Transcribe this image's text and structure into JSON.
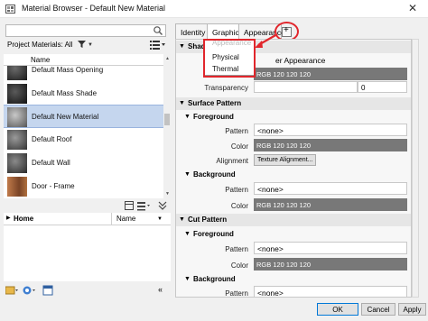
{
  "window": {
    "title": "Material Browser - Default New Material",
    "close_glyph": "✕"
  },
  "search": {
    "placeholder": ""
  },
  "project": {
    "label": "Project Materials: All",
    "column_name": "Name"
  },
  "materials": [
    {
      "label": "Default Mass Opening",
      "thumb": "#3a3a3a"
    },
    {
      "label": "Default Mass Shade",
      "thumb": "#2a2a2a"
    },
    {
      "label": "Default New Material",
      "thumb": "#777777",
      "selected": true
    },
    {
      "label": "Default Roof",
      "thumb": "#5a5a5a"
    },
    {
      "label": "Default Wall",
      "thumb": "#4a4a4a"
    },
    {
      "label": "Door - Frame",
      "thumb": "#a0643c"
    }
  ],
  "library": {
    "home_label": "Home",
    "name_label": "Name"
  },
  "tabs": [
    {
      "label": "Identity"
    },
    {
      "label": "Graphics",
      "active": true
    },
    {
      "label": "Appearance"
    }
  ],
  "add_asset": {
    "glyph": "+"
  },
  "popup_menu": {
    "items": [
      "Appearance",
      "Physical",
      "Thermal"
    ]
  },
  "shading": {
    "header": "Shading",
    "use_render": "er Appearance",
    "color_value": "RGB 120 120 120",
    "transparency_label": "Transparency",
    "transparency_value": "0"
  },
  "surface_pattern": {
    "header": "Surface Pattern",
    "foreground": {
      "header": "Foreground",
      "pattern_label": "Pattern",
      "pattern_value": "<none>",
      "color_label": "Color",
      "color_value": "RGB 120 120 120",
      "alignment_label": "Alignment",
      "alignment_button": "Texture Alignment..."
    },
    "background": {
      "header": "Background",
      "pattern_label": "Pattern",
      "pattern_value": "<none>",
      "color_label": "Color",
      "color_value": "RGB 120 120 120"
    }
  },
  "cut_pattern": {
    "header": "Cut Pattern",
    "foreground": {
      "header": "Foreground",
      "pattern_label": "Pattern",
      "pattern_value": "<none>",
      "color_label": "Color",
      "color_value": "RGB 120 120 120"
    },
    "background": {
      "header": "Background",
      "pattern_label": "Pattern",
      "pattern_value": "<none>"
    }
  },
  "footer": {
    "ok": "OK",
    "cancel": "Cancel",
    "apply": "Apply"
  },
  "colors": {
    "highlight": "#e1262c",
    "selection": "#c5d6ee",
    "color_swatch": "#787878"
  }
}
